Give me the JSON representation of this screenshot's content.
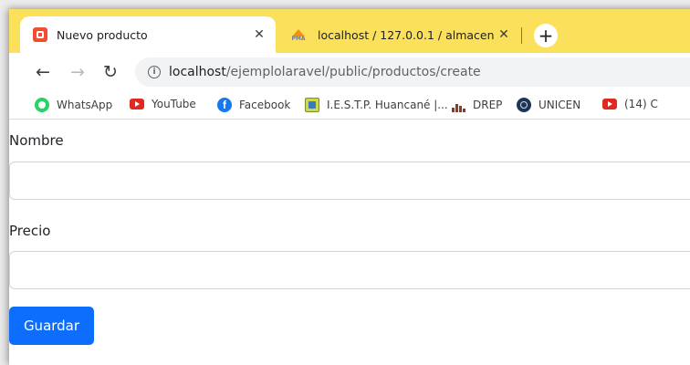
{
  "tabs": [
    {
      "title": "Nuevo producto",
      "icon": "laravel-favicon-icon",
      "active": true
    },
    {
      "title": "localhost / 127.0.0.1 / almacen /",
      "icon": "phpmyadmin-favicon-icon",
      "favicon_text": "PMA",
      "active": false
    }
  ],
  "toolbar": {
    "url_host": "localhost",
    "url_path": "/ejemplolaravel/public/productos/create",
    "icons": {
      "back": "back-arrow-icon",
      "forward": "forward-arrow-icon",
      "reload": "reload-icon",
      "info": "info-icon"
    }
  },
  "bookmarks": [
    {
      "label": "WhatsApp",
      "icon": "whatsapp-icon"
    },
    {
      "label": "YouTube",
      "icon": "youtube-icon"
    },
    {
      "label": "Facebook",
      "icon": "facebook-icon"
    },
    {
      "label": "I.E.S.T.P. Huancané |...",
      "icon": "iestp-icon"
    },
    {
      "label": "DREP",
      "icon": "drep-icon"
    },
    {
      "label": "UNICEN",
      "icon": "unicen-icon"
    },
    {
      "label": "(14) C",
      "icon": "youtube-icon"
    }
  ],
  "form": {
    "nombre_label": "Nombre",
    "nombre_value": "",
    "precio_label": "Precio",
    "precio_value": "",
    "save_label": "Guardar"
  },
  "colors": {
    "tabbar": "#fbe15b",
    "primary": "#0d6efd"
  }
}
